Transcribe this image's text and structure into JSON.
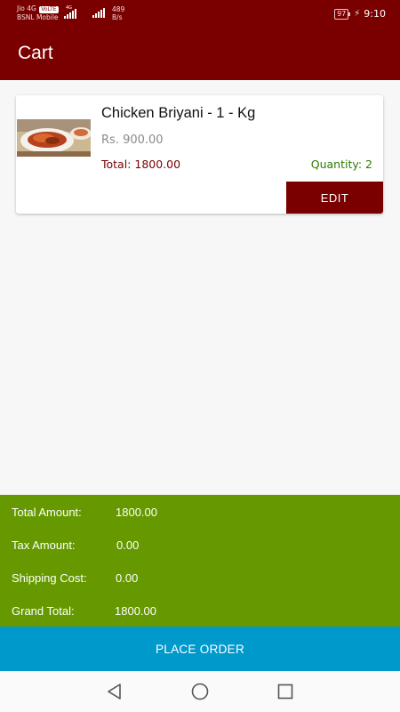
{
  "status_bar": {
    "carrier1": "Jio 4G",
    "volte": "VoLTE",
    "carrier2": "BSNL Mobile",
    "net_type": "4G",
    "speed_value": "489",
    "speed_unit": "B/s",
    "battery": "97",
    "time": "9:10"
  },
  "app_bar": {
    "title": "Cart"
  },
  "cart_item": {
    "image_icon": "biryani-dish-photo",
    "name": "Chicken Briyani - 1 - Kg",
    "price": "Rs. 900.00",
    "total": "Total: 1800.00",
    "quantity": "Quantity: 2",
    "edit_label": "EDIT"
  },
  "summary": {
    "total_amount_label": "Total Amount:",
    "total_amount_value": "1800.00",
    "tax_amount_label": "Tax Amount:",
    "tax_amount_value": "0.00",
    "shipping_cost_label": "Shipping Cost:",
    "shipping_cost_value": "0.00",
    "grand_total_label": "Grand Total:",
    "grand_total_value": "1800.00"
  },
  "place_order_label": "PLACE ORDER",
  "nav_bar": {
    "back_icon": "back-triangle-icon",
    "home_icon": "home-circle-icon",
    "recents_icon": "recents-square-icon"
  },
  "colors": {
    "primary": "#7a0000",
    "summary_bg": "#669900",
    "place_order_bg": "#0099cc",
    "quantity_text": "#2e7d00"
  }
}
